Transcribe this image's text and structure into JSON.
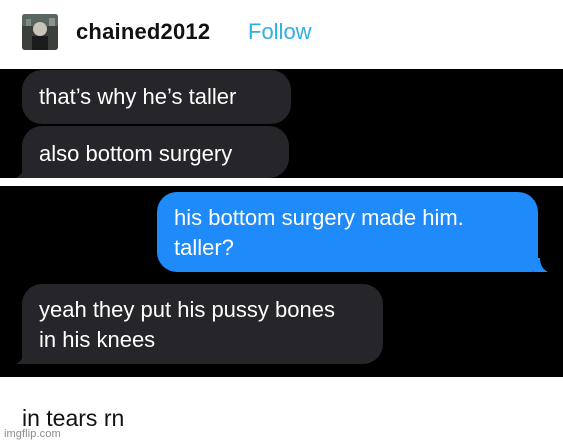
{
  "post": {
    "username": "chained2012",
    "follow_label": "Follow"
  },
  "messages": [
    {
      "text": "that’s why he’s taller",
      "direction": "received"
    },
    {
      "text": "also bottom surgery",
      "direction": "received"
    },
    {
      "text": "his bottom surgery made him.\ntaller?",
      "direction": "sent"
    },
    {
      "text": "yeah they put his pussy bones\nin his knees",
      "direction": "received"
    }
  ],
  "caption": "in tears rn",
  "watermark": "imgflip.com",
  "colors": {
    "follow": "#2fb0e3",
    "sent_bubble": "#1f8af9",
    "received_bubble": "#26252a",
    "panel_background": "#000000"
  }
}
